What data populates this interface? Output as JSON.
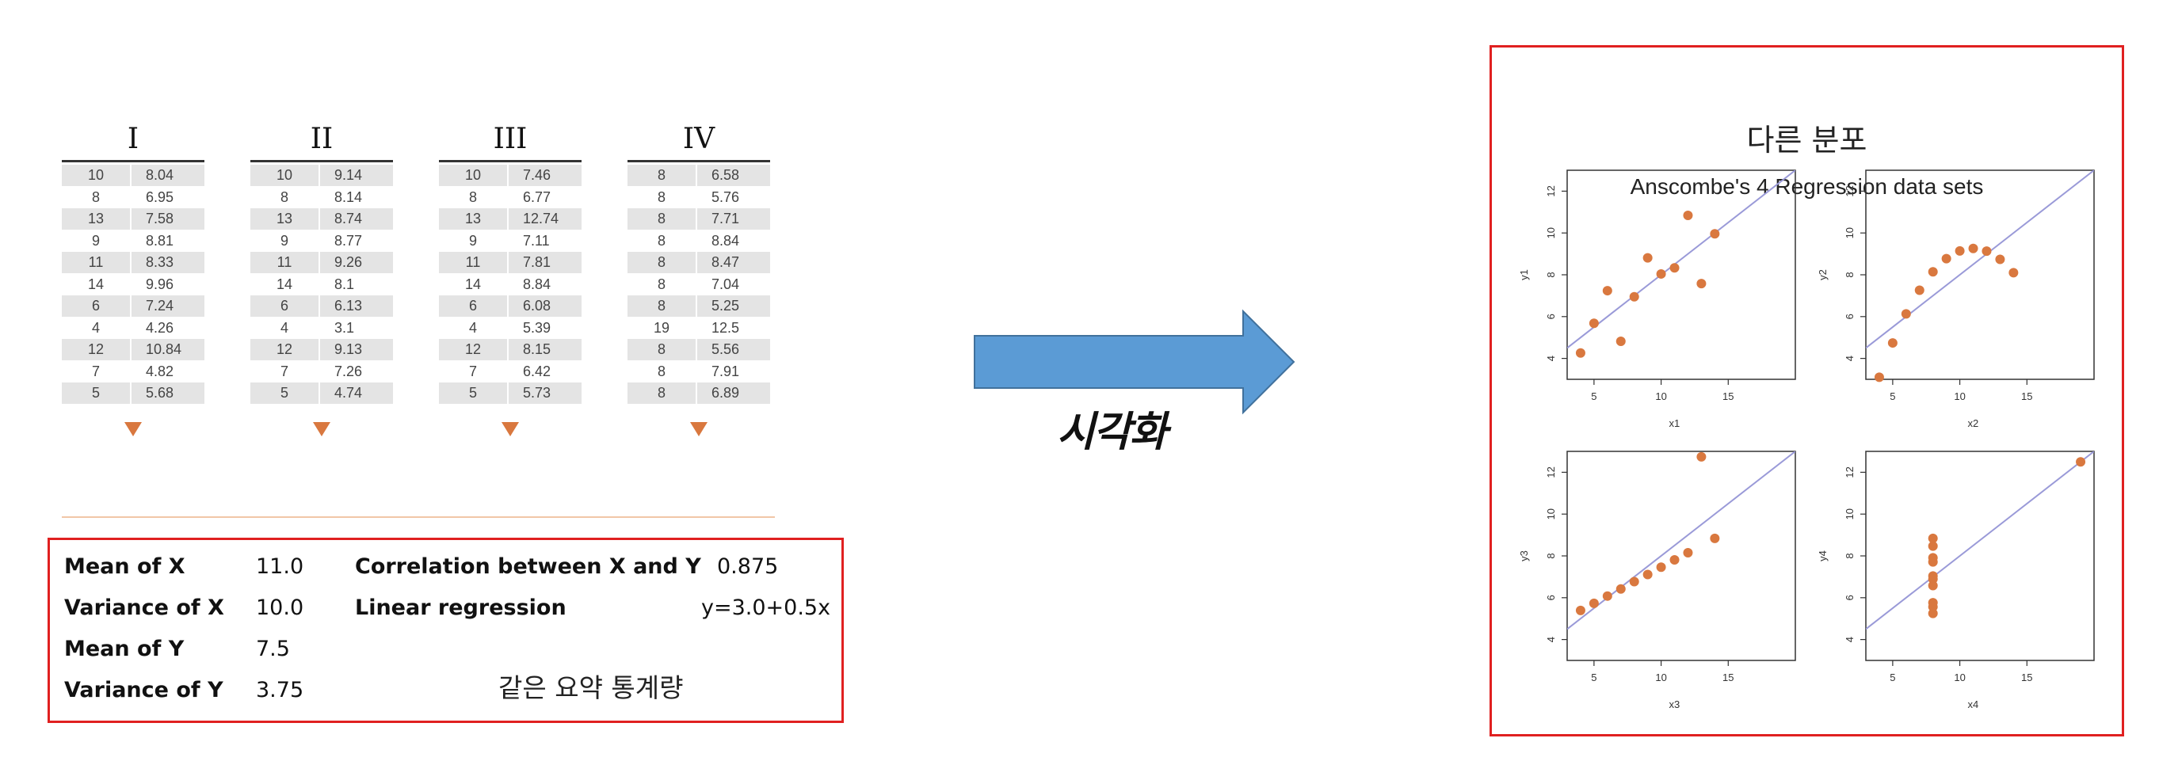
{
  "tables": [
    {
      "title": "I",
      "x": [
        "10",
        "8",
        "13",
        "9",
        "11",
        "14",
        "6",
        "4",
        "12",
        "7",
        "5"
      ],
      "y": [
        "8.04",
        "6.95",
        "7.58",
        "8.81",
        "8.33",
        "9.96",
        "7.24",
        "4.26",
        "10.84",
        "4.82",
        "5.68"
      ]
    },
    {
      "title": "II",
      "x": [
        "10",
        "8",
        "13",
        "9",
        "11",
        "14",
        "6",
        "4",
        "12",
        "7",
        "5"
      ],
      "y": [
        "9.14",
        "8.14",
        "8.74",
        "8.77",
        "9.26",
        "8.1",
        "6.13",
        "3.1",
        "9.13",
        "7.26",
        "4.74"
      ]
    },
    {
      "title": "III",
      "x": [
        "10",
        "8",
        "13",
        "9",
        "11",
        "14",
        "6",
        "4",
        "12",
        "7",
        "5"
      ],
      "y": [
        "7.46",
        "6.77",
        "12.74",
        "7.11",
        "7.81",
        "8.84",
        "6.08",
        "5.39",
        "8.15",
        "6.42",
        "5.73"
      ]
    },
    {
      "title": "IV",
      "x": [
        "8",
        "8",
        "8",
        "8",
        "8",
        "8",
        "8",
        "19",
        "8",
        "8",
        "8"
      ],
      "y": [
        "6.58",
        "5.76",
        "7.71",
        "8.84",
        "8.47",
        "7.04",
        "5.25",
        "12.5",
        "5.56",
        "7.91",
        "6.89"
      ]
    }
  ],
  "stats": {
    "mean_x_label": "Mean of X",
    "mean_x_value": "11.0",
    "var_x_label": "Variance of X",
    "var_x_value": "10.0",
    "mean_y_label": "Mean of Y",
    "mean_y_value": "7.5",
    "var_y_label": "Variance of Y",
    "var_y_value": "3.75",
    "corr_label": "Correlation between X and Y",
    "corr_value": "0.875",
    "linreg_label": "Linear regression",
    "linreg_value": "y=3.0+0.5x",
    "caption": "같은 요약 통계량"
  },
  "arrow_label": "시각화",
  "figure": {
    "caption": "다른 분포",
    "title": "Anscombe's 4 Regression data sets"
  },
  "colors": {
    "accent_red": "#e02020",
    "arrow_fill": "#5b9bd5",
    "arrow_stroke": "#41719c",
    "point": "#d9783f",
    "fit_line": "#9a9ad8"
  },
  "chart_data": [
    {
      "type": "scatter",
      "xlabel": "x1",
      "ylabel": "y1",
      "xlim": [
        3,
        20
      ],
      "ylim": [
        3,
        13
      ],
      "xticks": [
        "5",
        "10",
        "15"
      ],
      "yticks": [
        "4",
        "6",
        "8",
        "10",
        "12"
      ],
      "x": [
        10,
        8,
        13,
        9,
        11,
        14,
        6,
        4,
        12,
        7,
        5
      ],
      "y": [
        8.04,
        6.95,
        7.58,
        8.81,
        8.33,
        9.96,
        7.24,
        4.26,
        10.84,
        4.82,
        5.68
      ],
      "fit": {
        "intercept": 3.0,
        "slope": 0.5
      }
    },
    {
      "type": "scatter",
      "xlabel": "x2",
      "ylabel": "y2",
      "xlim": [
        3,
        20
      ],
      "ylim": [
        3,
        13
      ],
      "xticks": [
        "5",
        "10",
        "15"
      ],
      "yticks": [
        "4",
        "6",
        "8",
        "10",
        "12"
      ],
      "x": [
        10,
        8,
        13,
        9,
        11,
        14,
        6,
        4,
        12,
        7,
        5
      ],
      "y": [
        9.14,
        8.14,
        8.74,
        8.77,
        9.26,
        8.1,
        6.13,
        3.1,
        9.13,
        7.26,
        4.74
      ],
      "fit": {
        "intercept": 3.0,
        "slope": 0.5
      }
    },
    {
      "type": "scatter",
      "xlabel": "x3",
      "ylabel": "y3",
      "xlim": [
        3,
        20
      ],
      "ylim": [
        3,
        13
      ],
      "xticks": [
        "5",
        "10",
        "15"
      ],
      "yticks": [
        "4",
        "6",
        "8",
        "10",
        "12"
      ],
      "x": [
        10,
        8,
        13,
        9,
        11,
        14,
        6,
        4,
        12,
        7,
        5
      ],
      "y": [
        7.46,
        6.77,
        12.74,
        7.11,
        7.81,
        8.84,
        6.08,
        5.39,
        8.15,
        6.42,
        5.73
      ],
      "fit": {
        "intercept": 3.0,
        "slope": 0.5
      }
    },
    {
      "type": "scatter",
      "xlabel": "x4",
      "ylabel": "y4",
      "xlim": [
        3,
        20
      ],
      "ylim": [
        3,
        13
      ],
      "xticks": [
        "5",
        "10",
        "15"
      ],
      "yticks": [
        "4",
        "6",
        "8",
        "10",
        "12"
      ],
      "x": [
        8,
        8,
        8,
        8,
        8,
        8,
        8,
        19,
        8,
        8,
        8
      ],
      "y": [
        6.58,
        5.76,
        7.71,
        8.84,
        8.47,
        7.04,
        5.25,
        12.5,
        5.56,
        7.91,
        6.89
      ],
      "fit": {
        "intercept": 3.0,
        "slope": 0.5
      }
    }
  ]
}
